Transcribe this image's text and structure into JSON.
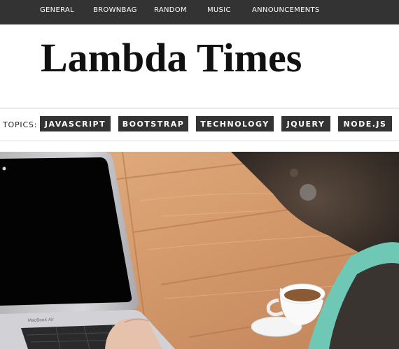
{
  "nav": {
    "items": [
      "GENERAL",
      "BROWNBAG",
      "RANDOM",
      "MUSIC",
      "ANNOUNCEMENTS"
    ]
  },
  "header": {
    "title": "Lambda Times"
  },
  "topics": {
    "label": "TOPICS:",
    "tabs": [
      "JAVASCRIPT",
      "BOOTSTRAP",
      "TECHNOLOGY",
      "JQUERY",
      "NODE.JS"
    ]
  },
  "hero": {
    "laptop_label": "MacBook Air",
    "colors": {
      "wood": "#d4996a",
      "screen": "#030303",
      "laptop_silver": "#c9c9cc",
      "shirt_teal": "#6fc8b6"
    }
  },
  "colors": {
    "nav_bg": "#333333",
    "tab_bg": "#333333",
    "title": "#111111"
  }
}
